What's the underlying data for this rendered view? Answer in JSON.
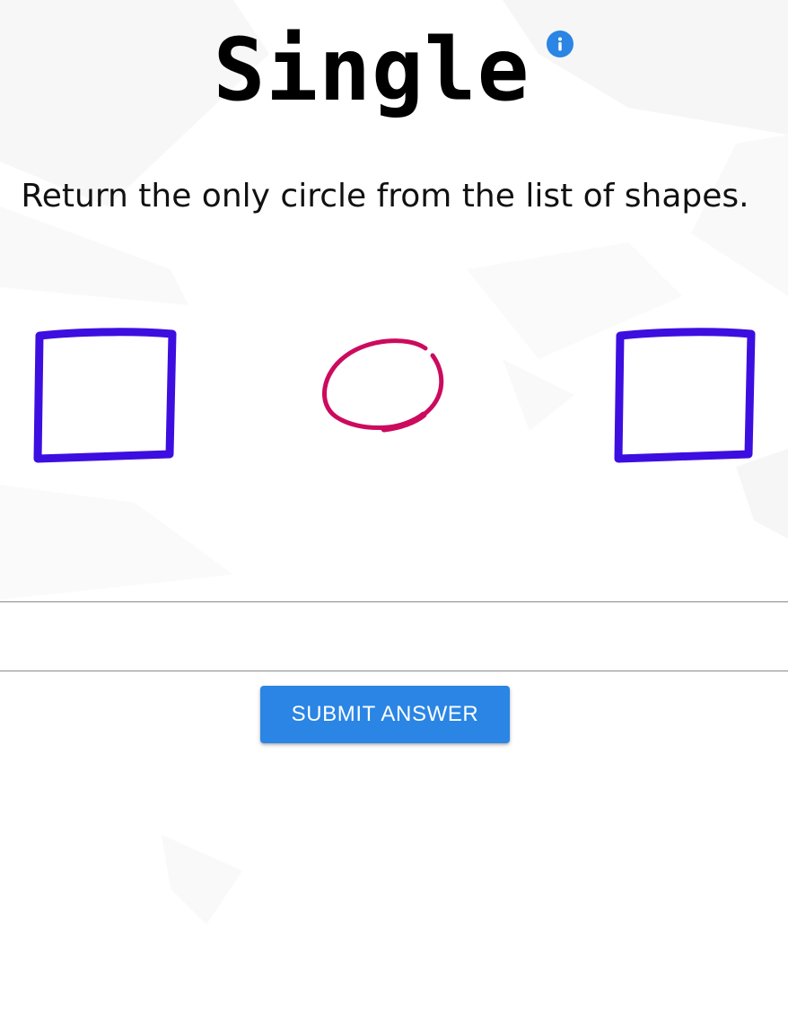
{
  "header": {
    "title": "Single",
    "info_icon": "info-icon"
  },
  "prompt": {
    "instruction": "Return the only circle from the list of shapes."
  },
  "shapes": [
    {
      "kind": "square",
      "color": "#3d0ee0"
    },
    {
      "kind": "circle",
      "color": "#cc0a5e"
    },
    {
      "kind": "square",
      "color": "#3d0ee0"
    }
  ],
  "answer": {
    "value": ""
  },
  "actions": {
    "submit_label": "SUBMIT ANSWER"
  },
  "colors": {
    "accent": "#2a85e4",
    "square": "#3d0ee0",
    "circle": "#cc0a5e"
  }
}
